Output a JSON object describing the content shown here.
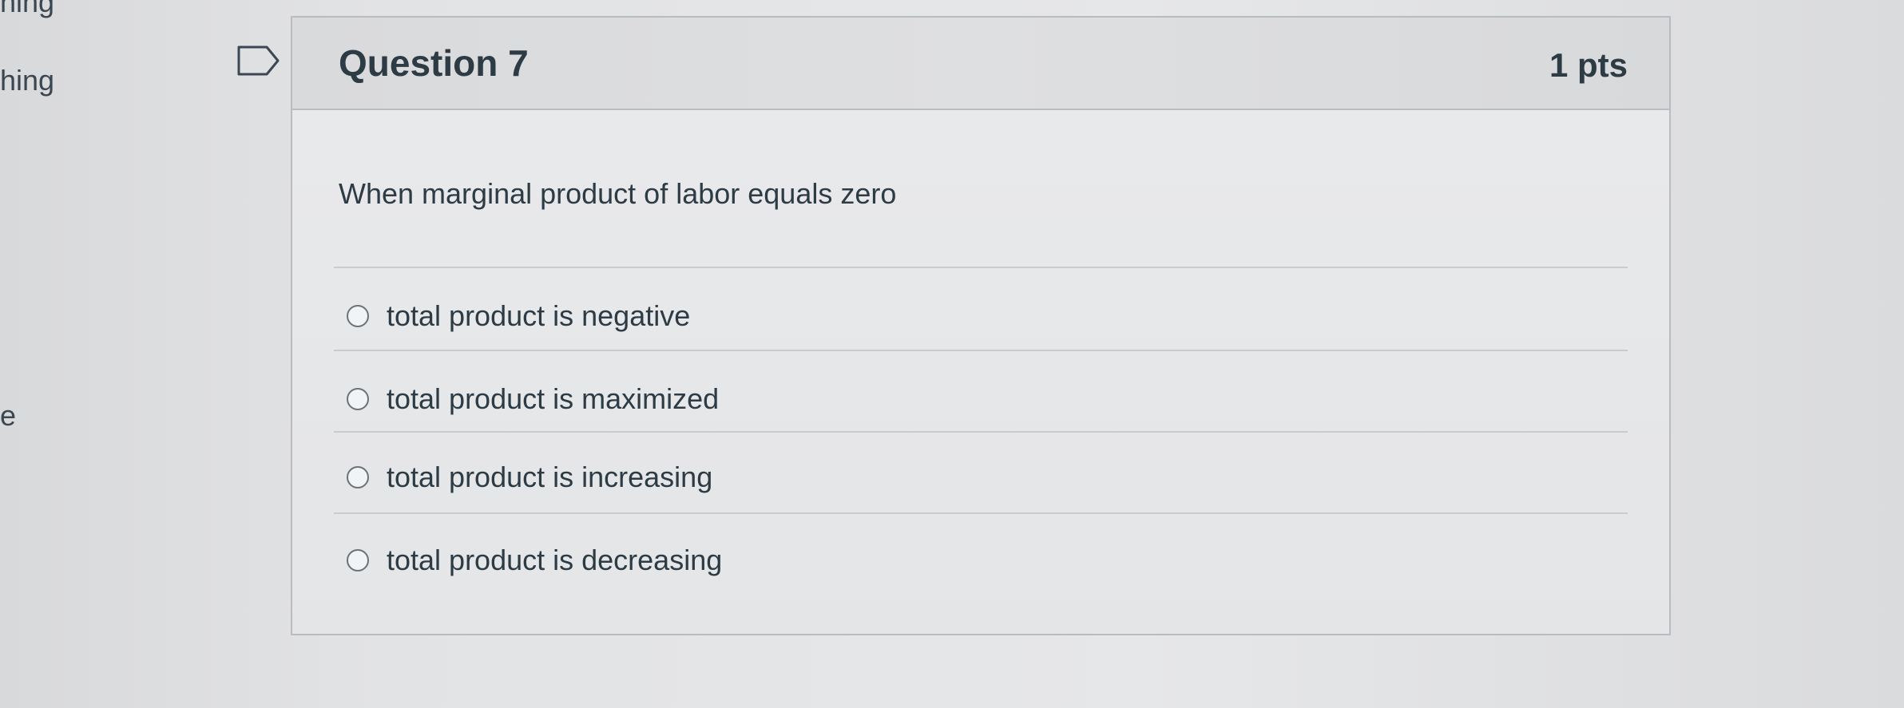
{
  "side_nav": {
    "items": [
      "hing",
      "hing",
      "e"
    ]
  },
  "question": {
    "title": "Question 7",
    "points": "1 pts",
    "text": "When marginal product of labor equals zero",
    "answers": [
      {
        "label": "total product is negative",
        "selected": false
      },
      {
        "label": "total product is maximized",
        "selected": false
      },
      {
        "label": "total product is increasing",
        "selected": false
      },
      {
        "label": "total product is decreasing",
        "selected": false
      }
    ]
  },
  "icons": {
    "flag": "flag-icon",
    "radio": "radio-unchecked-icon"
  },
  "colors": {
    "text": "#2d3b45",
    "border": "#b8bcc0",
    "header_bg": "#dcdddf"
  }
}
